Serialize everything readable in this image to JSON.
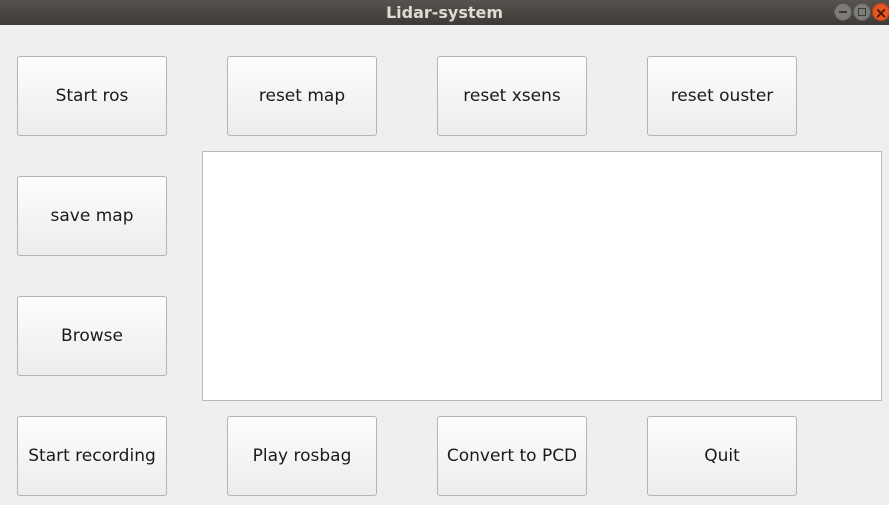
{
  "window": {
    "title": "Lidar-system",
    "controls": {
      "minimize": "minimize-icon",
      "maximize": "maximize-icon",
      "close": "close-icon"
    }
  },
  "buttons": {
    "start_ros": "Start ros",
    "reset_map": "reset map",
    "reset_xsens": "reset xsens",
    "reset_ouster": "reset ouster",
    "save_map": "save map",
    "browse": "Browse",
    "start_recording": "Start recording",
    "play_rosbag": "Play rosbag",
    "convert_pcd": "Convert to PCD",
    "quit": "Quit"
  },
  "output": {
    "text": ""
  }
}
